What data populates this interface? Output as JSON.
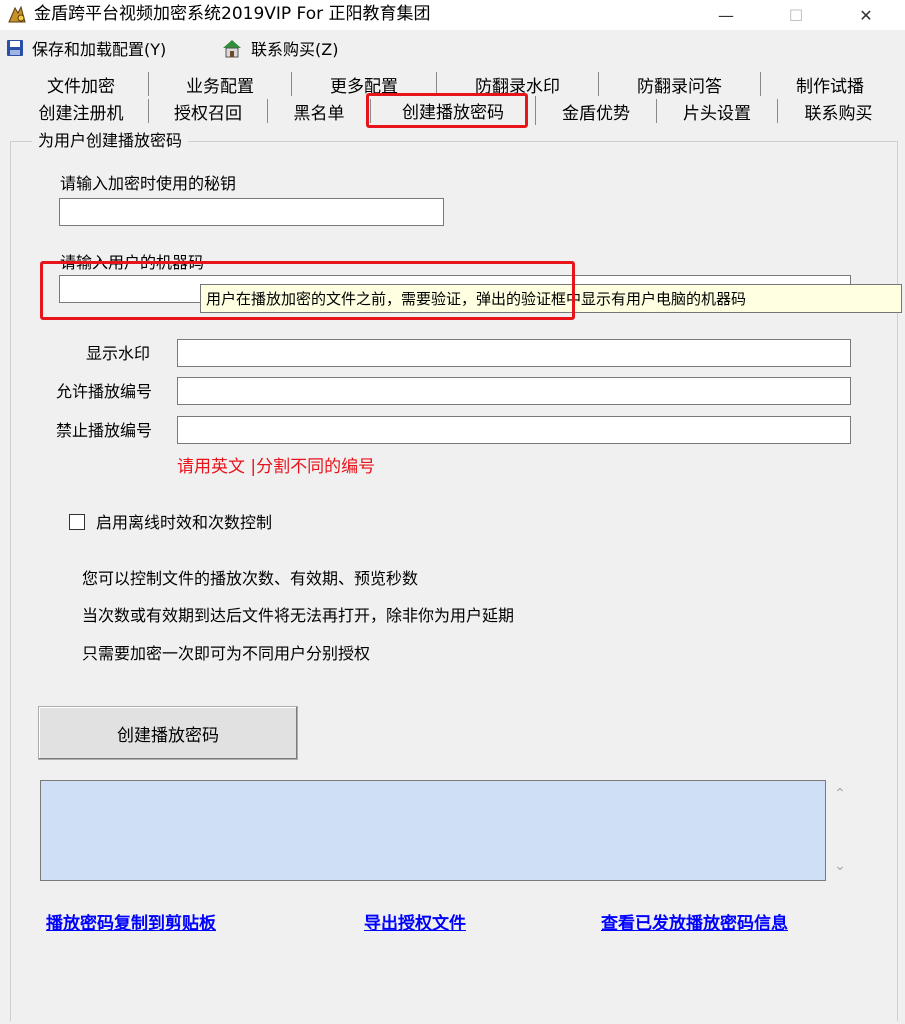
{
  "window": {
    "title": "金盾跨平台视频加密系统2019VIP For 正阳教育集团",
    "minimize": "—",
    "maximize": "☐",
    "close": "✕"
  },
  "menu": {
    "save_load": "保存和加载配置(Y)",
    "contact_buy": "联系购买(Z)"
  },
  "tabs": {
    "row1": [
      "文件加密",
      "业务配置",
      "更多配置",
      "防翻录水印",
      "防翻录问答",
      "制作试播"
    ],
    "row2": [
      "创建注册机",
      "授权召回",
      "黑名单",
      "创建播放密码",
      "金盾优势",
      "片头设置",
      "联系购买"
    ]
  },
  "form": {
    "group_title": "为用户创建播放密码",
    "secret_key_label": "请输入加密时使用的秘钥",
    "secret_key_value": "",
    "machine_code_label": "请输入用户的机器码",
    "machine_code_value": "",
    "tooltip": "用户在播放加密的文件之前，需要验证，弹出的验证框中显示有用户电脑的机器码",
    "watermark_label": "显示水印",
    "watermark_value": "",
    "allow_label": "允许播放编号",
    "allow_value": "",
    "deny_label": "禁止播放编号",
    "deny_value": "",
    "hint": "请用英文 |分割不同的编号",
    "offline_checkbox_label": "启用离线时效和次数控制",
    "offline_checked": false,
    "desc_line1": "您可以控制文件的播放次数、有效期、预览秒数",
    "desc_line2": "当次数或有效期到达后文件将无法再打开，除非你为用户延期",
    "desc_line3": "只需要加密一次即可为不同用户分别授权",
    "create_button": "创建播放密码",
    "output_value": ""
  },
  "links": {
    "copy": "播放密码复制到剪贴板",
    "export": "导出授权文件",
    "view": "查看已发放播放密码信息"
  },
  "colors": {
    "highlight_red": "#e8141c",
    "hint_red": "#e8141c",
    "link_blue": "#0000ff",
    "output_bg": "#cfe0f6",
    "tooltip_bg": "#ffffe1"
  }
}
